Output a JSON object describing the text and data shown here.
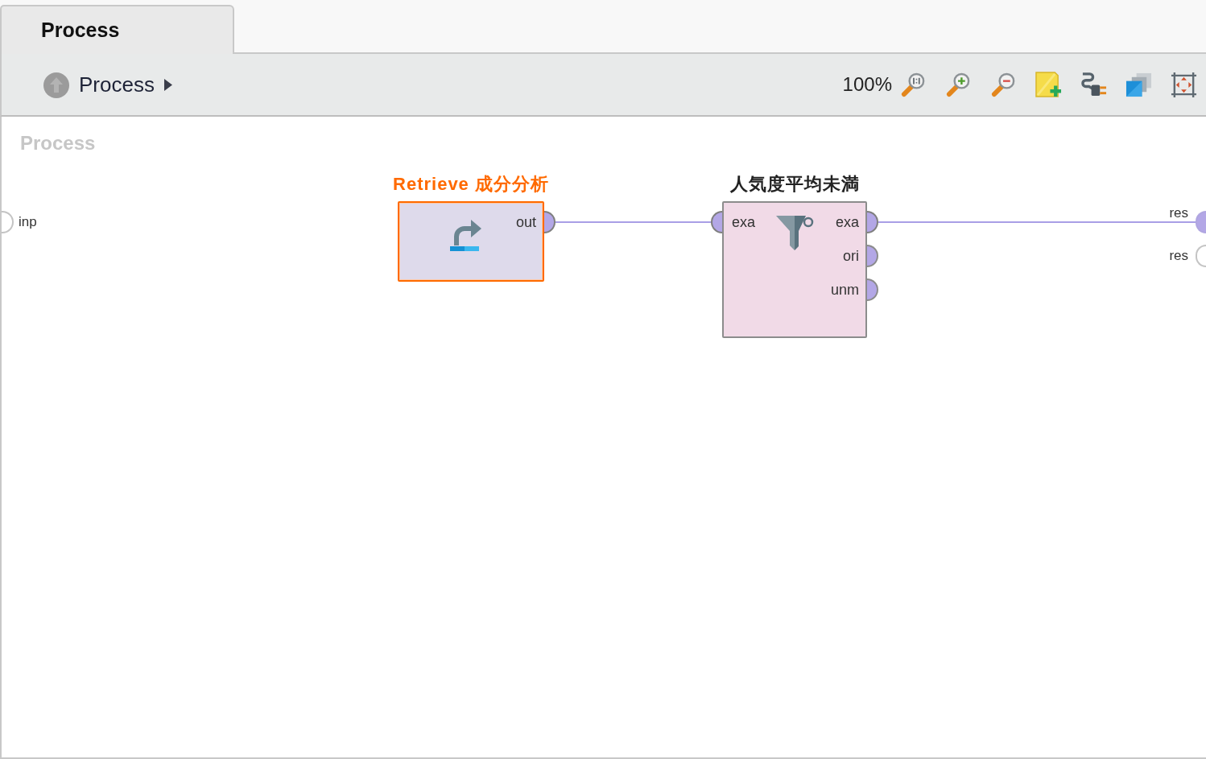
{
  "tabs": [
    {
      "label": "Process",
      "selected": true
    }
  ],
  "breadcrumb": {
    "up_button": {
      "disabled": true
    },
    "path": [
      {
        "label": "Process"
      }
    ]
  },
  "toolbar": {
    "zoom": "100%"
  },
  "canvas": {
    "title": "Process",
    "inputs": [
      {
        "label": "inp",
        "color": "#ffffff",
        "connected": false
      }
    ],
    "outputs": [
      {
        "label": "res",
        "color": "#b3a7e6",
        "connected": true
      },
      {
        "label": "res",
        "color": "#ffffff",
        "connected": false
      }
    ],
    "operators": [
      {
        "title": "Retrieve 成分分析",
        "kind": "retrieve",
        "selected": true,
        "outputs": [
          {
            "label": "out",
            "color": "#b3a7e6",
            "connected": true
          }
        ]
      },
      {
        "title": "人気度平均未満",
        "kind": "filter",
        "selected": false,
        "inputs": [
          {
            "label": "exa",
            "color": "#b3a7e6",
            "connected": true
          }
        ],
        "outputs": [
          {
            "label": "exa",
            "color": "#b3a7e6",
            "connected": true
          },
          {
            "label": "ori",
            "color": "#b3a7e6",
            "connected": false
          },
          {
            "label": "unm",
            "color": "#b3a7e6",
            "connected": false
          }
        ]
      }
    ]
  }
}
